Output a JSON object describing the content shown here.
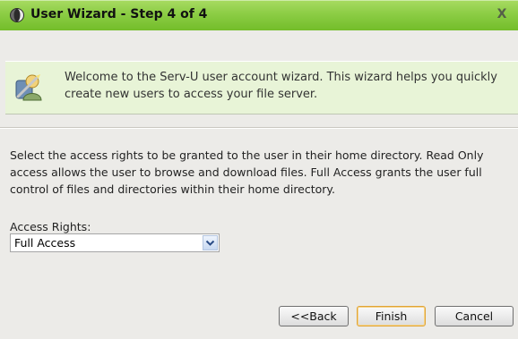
{
  "window": {
    "title": "User Wizard - Step 4 of 4",
    "close_label": "X"
  },
  "banner": {
    "text": "Welcome to the Serv-U user account wizard. This wizard helps you quickly create new users to access your file server."
  },
  "main": {
    "description_lines": [
      "Select the access rights to be granted to the user in their home directory. Read Only",
      "access allows the user to browse and download files. Full Access grants the user full",
      "control of files and directories within their home directory."
    ],
    "access_rights": {
      "label": "Access Rights:",
      "selected": "Full Access"
    }
  },
  "buttons": {
    "back_label": "<<Back",
    "finish_label": "Finish",
    "cancel_label": "Cancel"
  },
  "icons": {
    "title_icon": "serv-u-logo-icon",
    "banner_icon": "user-wizard-icon",
    "dropdown_icon": "chevron-down-icon"
  },
  "colors": {
    "titlebar": "#8ccd45",
    "banner_bg": "#e8f4d7",
    "window_bg": "#ecebe8",
    "finish_border": "#e0a436"
  }
}
